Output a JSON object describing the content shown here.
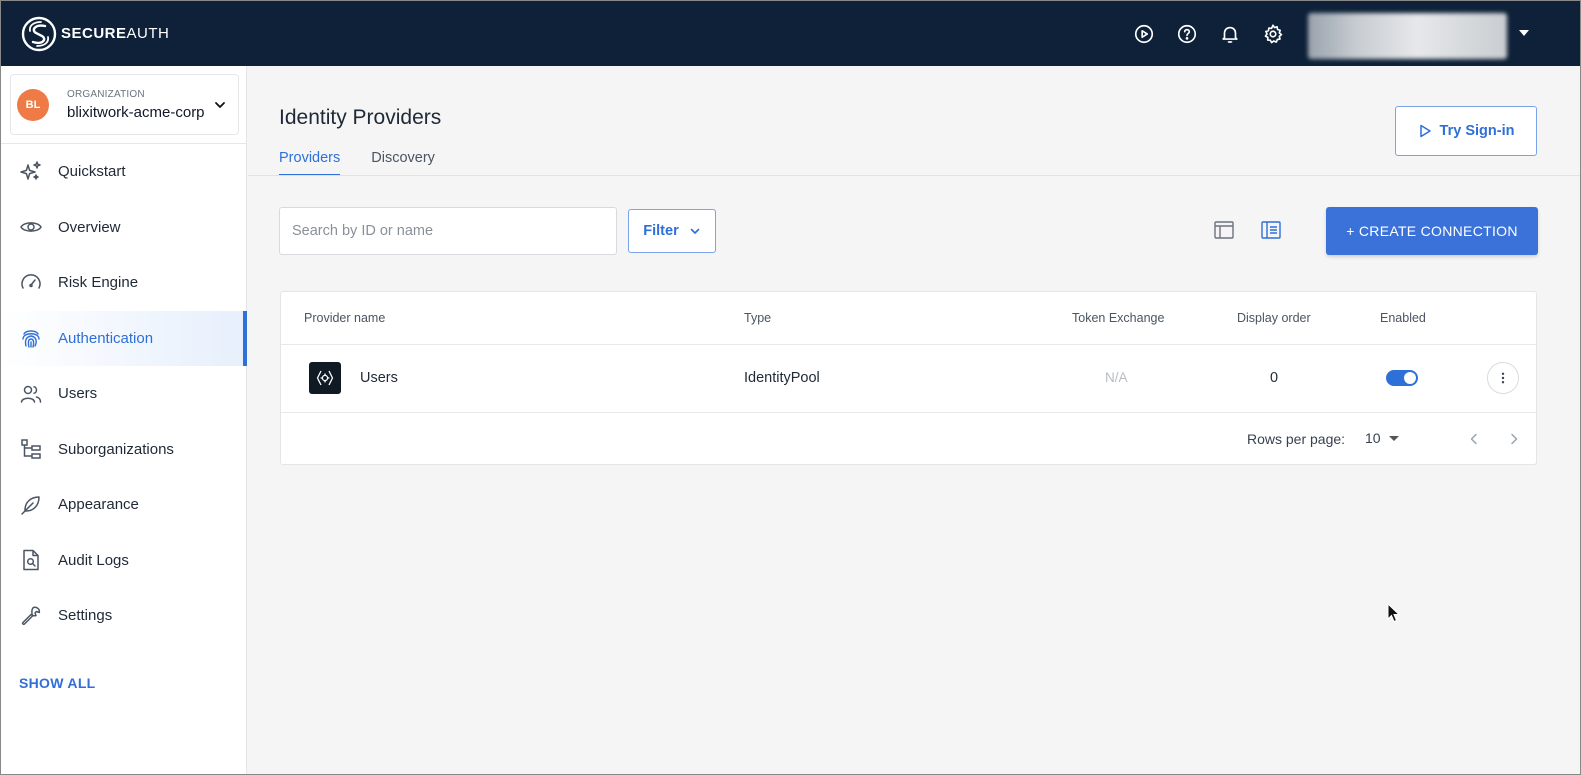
{
  "brand": {
    "name_bold": "SECURE",
    "name_light": "AUTH"
  },
  "topbar": {
    "icons": [
      "play-circle-icon",
      "help-circle-icon",
      "bell-icon",
      "gear-icon"
    ],
    "user_menu_caret": "caret-down-icon"
  },
  "organization": {
    "avatar_initials": "BL",
    "label": "ORGANIZATION",
    "name": "blixitwork-acme-corp"
  },
  "sidebar": {
    "items": [
      {
        "label": "Quickstart",
        "icon": "sparkles-icon",
        "active": false
      },
      {
        "label": "Overview",
        "icon": "eye-icon",
        "active": false
      },
      {
        "label": "Risk Engine",
        "icon": "gauge-icon",
        "active": false
      },
      {
        "label": "Authentication",
        "icon": "fingerprint-icon",
        "active": true
      },
      {
        "label": "Users",
        "icon": "users-icon",
        "active": false
      },
      {
        "label": "Suborganizations",
        "icon": "hierarchy-icon",
        "active": false
      },
      {
        "label": "Appearance",
        "icon": "feather-icon",
        "active": false
      },
      {
        "label": "Audit Logs",
        "icon": "document-search-icon",
        "active": false
      },
      {
        "label": "Settings",
        "icon": "wrench-icon",
        "active": false
      }
    ],
    "show_all": "SHOW ALL"
  },
  "page": {
    "title": "Identity Providers",
    "tabs": [
      {
        "label": "Providers",
        "active": true
      },
      {
        "label": "Discovery",
        "active": false
      }
    ],
    "try_signin": "Try Sign-in"
  },
  "toolbar": {
    "search_placeholder": "Search by ID or name",
    "filter_label": "Filter",
    "create_label": "+ CREATE CONNECTION"
  },
  "table": {
    "columns": [
      "Provider name",
      "Type",
      "Token Exchange",
      "Display order",
      "Enabled"
    ],
    "rows": [
      {
        "provider_name": "Users",
        "type": "IdentityPool",
        "token_exchange": "N/A",
        "display_order": "0",
        "enabled": true
      }
    ],
    "rows_per_page_label": "Rows per page:",
    "rows_per_page_value": "10"
  },
  "colors": {
    "topbar": "#0e2138",
    "accent": "#2f6fd8",
    "avatar": "#ee7a45"
  }
}
